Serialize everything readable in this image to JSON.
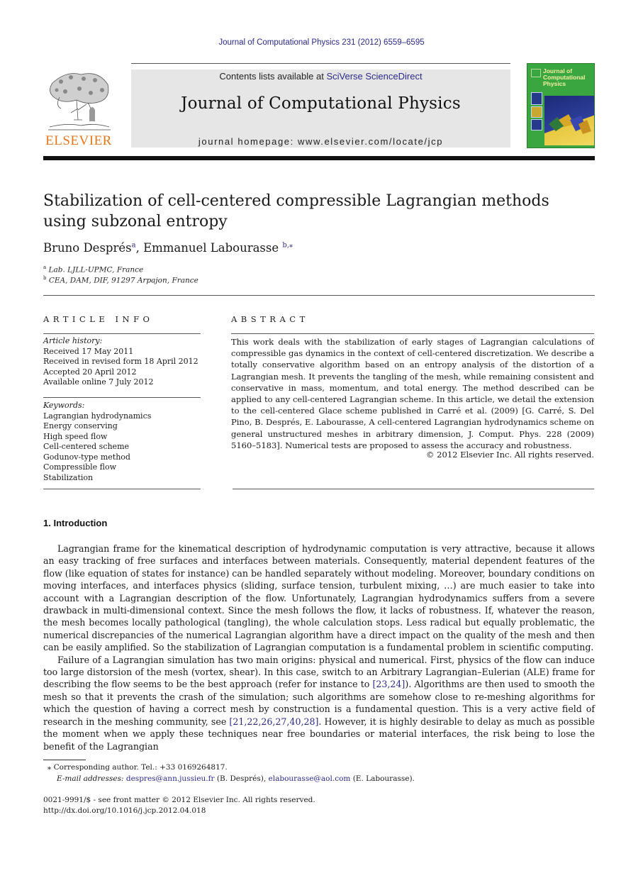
{
  "running_head": "Journal of Computational Physics 231 (2012) 6559–6595",
  "publisher": {
    "logo_text": "ELSEVIER",
    "brand_color": "#e8761a"
  },
  "masthead": {
    "contents_prefix": "Contents lists available at ",
    "contents_link": "SciVerse ScienceDirect",
    "journal_name": "Journal of Computational Physics",
    "homepage_label": "journal homepage: www.elsevier.com/locate/jcp"
  },
  "cover": {
    "title_lines": [
      "Journal of",
      "Computational",
      "Physics"
    ],
    "background_color": "#3aa640"
  },
  "article": {
    "title_line1": "Stabilization of cell-centered compressible Lagrangian methods",
    "title_line2": "using subzonal entropy",
    "authors": [
      {
        "name": "Bruno Després",
        "mark": "a"
      },
      {
        "name": "Emmanuel Labourasse",
        "mark": "b,⁎"
      }
    ],
    "affiliations": [
      {
        "mark": "a",
        "text": "Lab. LJLL-UPMC, France"
      },
      {
        "mark": "b",
        "text": "CEA, DAM, DIF, 91297 Arpajon, France"
      }
    ]
  },
  "article_info": {
    "heading": "ARTICLE INFO",
    "history_label": "Article history:",
    "history": [
      "Received 17 May 2011",
      "Received in revised form 18 April 2012",
      "Accepted 20 April 2012",
      "Available online 7 July 2012"
    ],
    "keywords_label": "Keywords:",
    "keywords": [
      "Lagrangian hydrodynamics",
      "Energy conserving",
      "High speed flow",
      "Cell-centered scheme",
      "Godunov-type method",
      "Compressible flow",
      "Stabilization"
    ]
  },
  "abstract": {
    "heading": "ABSTRACT",
    "text": "This work deals with the stabilization of early stages of Lagrangian calculations of compressible gas dynamics in the context of cell-centered discretization. We describe a totally conservative algorithm based on an entropy analysis of the distortion of a Lagrangian mesh. It prevents the tangling of the mesh, while remaining consistent and conservative in mass, momentum, and total energy. The method described can be applied to any cell-centered Lagrangian scheme. In this article, we detail the extension to the cell-centered Glace scheme published in Carré et al. (2009) [G. Carré, S. Del Pino, B. Després, E. Labourasse, A cell-centered Lagrangian hydrodynamics scheme on general unstructured meshes in arbitrary dimension, J. Comput. Phys. 228 (2009) 5160–5183]. Numerical tests are proposed to assess the accuracy and robustness.",
    "copyright": "© 2012 Elsevier Inc. All rights reserved."
  },
  "introduction": {
    "heading": "1. Introduction",
    "para1": "Lagrangian frame for the kinematical description of hydrodynamic computation is very attractive, because it allows an easy tracking of free surfaces and interfaces between materials. Consequently, material dependent features of the flow (like equation of states for instance) can be handled separately without modeling. Moreover, boundary conditions on moving interfaces, and interfaces physics (sliding, surface tension, turbulent mixing, …) are much easier to take into account with a Lagrangian description of the flow. Unfortunately, Lagrangian hydrodynamics suffers from a severe drawback in multi-dimensional context. Since the mesh follows the flow, it lacks of robustness. If, whatever the reason, the mesh becomes locally pathological (tangling), the whole calculation stops. Less radical but equally problematic, the numerical discrepancies of the numerical Lagrangian algorithm have a direct impact on the quality of the mesh and then can be easily amplified. So the stabilization of Lagrangian computation is a fundamental problem in scientific computing.",
    "para2_a": "Failure of a Lagrangian simulation has two main origins: physical and numerical. First, physics of the flow can induce too large distorsion of the mesh (vortex, shear). In this case, switch to an Arbitrary Lagrangian–Eulerian (ALE) frame for describing the flow seems to be the best approach (refer for instance to ",
    "para2_ref1": "[23,24]",
    "para2_b": "). Algorithms are then used to smooth the mesh so that it prevents the crash of the simulation; such algorithms are somehow close to re-meshing algorithms for which the question of having a correct mesh by construction is a fundamental question. This is a very active field of research in the meshing community, see ",
    "para2_ref2": "[21,22,26,27,40,28]",
    "para2_c": ". However, it is highly desirable to delay as much as possible the moment when we apply these techniques near free boundaries or material interfaces, the risk being to lose the benefit of the Lagrangian"
  },
  "footnotes": {
    "corresponding": "⁎ Corresponding author. Tel.: +33 0169264817.",
    "email_label": "E-mail addresses: ",
    "email1": "despres@ann.jussieu.fr",
    "email1_owner": " (B. Després), ",
    "email2": "elabourasse@aol.com",
    "email2_owner": " (E. Labourasse)."
  },
  "front_matter": {
    "issn_line": "0021-9991/$ - see front matter © 2012 Elsevier Inc. All rights reserved.",
    "doi": "http://dx.doi.org/10.1016/j.jcp.2012.04.018"
  }
}
